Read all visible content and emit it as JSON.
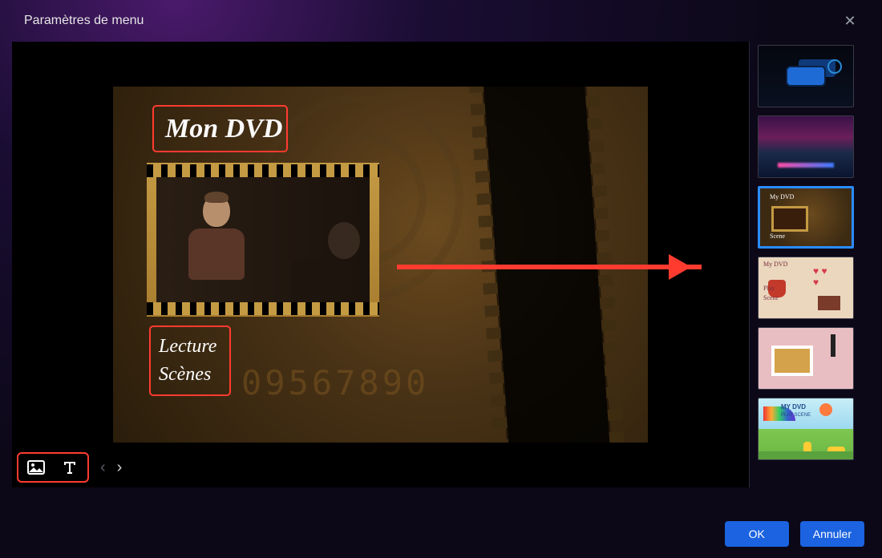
{
  "dialog": {
    "title": "Paramètres de menu",
    "close_label": "✕"
  },
  "menu": {
    "title": "Mon DVD",
    "link_play": "Lecture",
    "link_scenes": "Scènes",
    "background_digits": "09567890"
  },
  "toolbar": {
    "image_tool": "Image",
    "text_tool": "Texte",
    "prev": "‹",
    "next": "›"
  },
  "templates": {
    "items": [
      {
        "name": "tech-dark"
      },
      {
        "name": "galaxy"
      },
      {
        "name": "film-sepia",
        "title": "My DVD",
        "sub": "Scene"
      },
      {
        "name": "romance-cafe",
        "title": "My DVD",
        "play": "Play",
        "scene": "Scene"
      },
      {
        "name": "framed-pink"
      },
      {
        "name": "kids-cartoon",
        "title": "MY DVD",
        "sub": "PLAY  SCENE"
      }
    ],
    "selected_index": 2
  },
  "buttons": {
    "ok": "OK",
    "cancel": "Annuler"
  }
}
